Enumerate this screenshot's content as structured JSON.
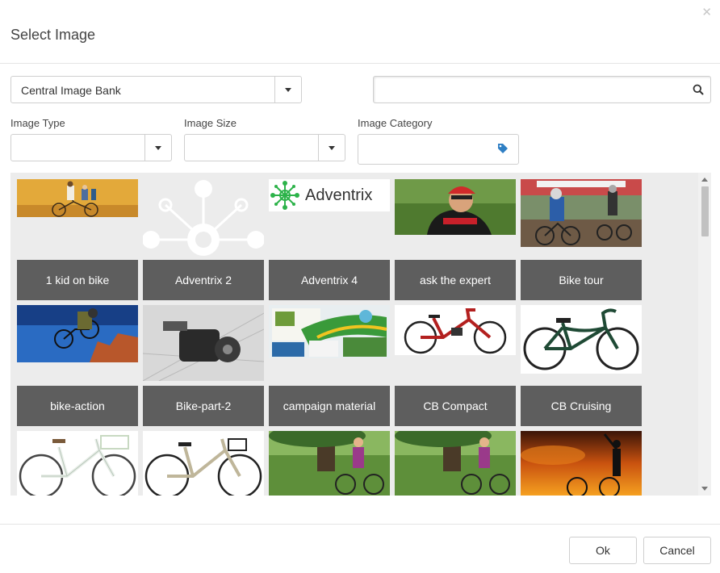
{
  "dialog": {
    "title": "Select Image"
  },
  "source_select": {
    "value": "Central Image Bank"
  },
  "search": {
    "placeholder": "",
    "value": ""
  },
  "filters": {
    "image_type_label": "Image Type",
    "image_size_label": "Image Size",
    "image_category_label": "Image Category",
    "image_type_value": "",
    "image_size_value": ""
  },
  "gallery": {
    "logo_text": "Adventrix",
    "items": [
      {
        "caption": "1 kid on bike",
        "thumb": "family-bike-photo"
      },
      {
        "caption": "Adventrix 2",
        "thumb": "adventrix-network-graphic"
      },
      {
        "caption": "Adventrix 4",
        "thumb": "adventrix-logo"
      },
      {
        "caption": "ask the expert",
        "thumb": "cyclist-portrait-photo"
      },
      {
        "caption": "Bike tour",
        "thumb": "cyclocross-race-photo"
      },
      {
        "caption": "bike-action",
        "thumb": "bmx-jump-photo"
      },
      {
        "caption": "Bike-part-2",
        "thumb": "derailleur-closeup-photo"
      },
      {
        "caption": "campaign material",
        "thumb": "brochures-photo"
      },
      {
        "caption": "CB Compact",
        "thumb": "red-city-bike-photo"
      },
      {
        "caption": "CB Cruising",
        "thumb": "green-cruiser-bike-photo"
      },
      {
        "caption": "",
        "thumb": "white-city-bike-photo"
      },
      {
        "caption": "",
        "thumb": "beige-city-bike-photo"
      },
      {
        "caption": "",
        "thumb": "park-cyclist-photo"
      },
      {
        "caption": "",
        "thumb": "park-cyclist-photo-2"
      },
      {
        "caption": "",
        "thumb": "sunset-cyclist-photo"
      }
    ]
  },
  "footer": {
    "ok_label": "Ok",
    "cancel_label": "Cancel"
  },
  "colors": {
    "caption_bg": "#5e5e5e",
    "gallery_bg": "#ececec",
    "brand_green": "#2db34a",
    "tag_icon": "#2f7fc4"
  }
}
